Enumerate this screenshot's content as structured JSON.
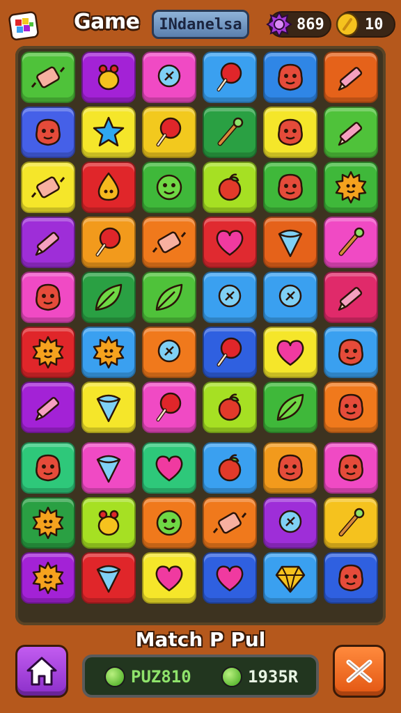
{
  "header": {
    "title": "Game",
    "level_label": "INdanelsa",
    "gems": "869",
    "coins": "10"
  },
  "colors": {
    "background": "#b5581c",
    "board": "#3d3320"
  },
  "board": {
    "rows": 10,
    "cols": 6,
    "tiles": [
      {
        "color": "#4fc23a",
        "icon": "candy-icon"
      },
      {
        "color": "#a322d6",
        "icon": "bug-icon"
      },
      {
        "color": "#f04ac4",
        "icon": "pin-icon"
      },
      {
        "color": "#3aa0f0",
        "icon": "lollipop-icon"
      },
      {
        "color": "#2f86e6",
        "icon": "monster-icon"
      },
      {
        "color": "#e5621a",
        "icon": "pencil-icon"
      },
      {
        "color": "#4560e8",
        "icon": "monster-icon"
      },
      {
        "color": "#f5e62a",
        "icon": "star-icon"
      },
      {
        "color": "#f2c91e",
        "icon": "lollipop-icon"
      },
      {
        "color": "#2aa043",
        "icon": "wand-icon"
      },
      {
        "color": "#f5e62a",
        "icon": "monster-icon"
      },
      {
        "color": "#4fc23a",
        "icon": "pencil-icon"
      },
      {
        "color": "#f5e62a",
        "icon": "candy-icon"
      },
      {
        "color": "#e0262a",
        "icon": "drop-icon"
      },
      {
        "color": "#3fb83a",
        "icon": "face-icon"
      },
      {
        "color": "#a6e023",
        "icon": "apple-icon"
      },
      {
        "color": "#3fb83a",
        "icon": "monster-icon"
      },
      {
        "color": "#3fb83a",
        "icon": "sun-icon"
      },
      {
        "color": "#9e2ed8",
        "icon": "pencil-icon"
      },
      {
        "color": "#f29a1c",
        "icon": "lollipop-icon"
      },
      {
        "color": "#f0791c",
        "icon": "candy-icon"
      },
      {
        "color": "#e02a30",
        "icon": "heart-icon"
      },
      {
        "color": "#e5621a",
        "icon": "cone-icon"
      },
      {
        "color": "#f04ac4",
        "icon": "wand-icon"
      },
      {
        "color": "#f04ac4",
        "icon": "monster-icon"
      },
      {
        "color": "#2aa043",
        "icon": "leaf-icon"
      },
      {
        "color": "#4fc23a",
        "icon": "leaf-icon"
      },
      {
        "color": "#3aa0f0",
        "icon": "pin-icon"
      },
      {
        "color": "#3aa0f0",
        "icon": "pin-icon"
      },
      {
        "color": "#e02a6a",
        "icon": "pencil-icon"
      },
      {
        "color": "#e0262a",
        "icon": "sun-icon"
      },
      {
        "color": "#3aa0f0",
        "icon": "sun-icon"
      },
      {
        "color": "#f0791c",
        "icon": "pin-icon"
      },
      {
        "color": "#2f60e0",
        "icon": "lollipop-icon"
      },
      {
        "color": "#f5e62a",
        "icon": "heart-icon"
      },
      {
        "color": "#3aa0f0",
        "icon": "monster-icon"
      },
      {
        "color": "#a322d6",
        "icon": "pencil-icon"
      },
      {
        "color": "#f5e62a",
        "icon": "cone-icon"
      },
      {
        "color": "#f04ac4",
        "icon": "lollipop-icon"
      },
      {
        "color": "#a6e023",
        "icon": "apple-icon"
      },
      {
        "color": "#3fb83a",
        "icon": "leaf-icon"
      },
      {
        "color": "#f0791c",
        "icon": "monster-icon"
      },
      {
        "color": "#2ec87a",
        "icon": "monster-icon"
      },
      {
        "color": "#f04ac4",
        "icon": "cone-icon"
      },
      {
        "color": "#2ec87a",
        "icon": "heart-icon"
      },
      {
        "color": "#3aa0f0",
        "icon": "apple-icon"
      },
      {
        "color": "#f29a1c",
        "icon": "monster-icon"
      },
      {
        "color": "#f04ac4",
        "icon": "monster-icon"
      },
      {
        "color": "#2aa043",
        "icon": "sun-icon"
      },
      {
        "color": "#a6e023",
        "icon": "bug-icon"
      },
      {
        "color": "#f0791c",
        "icon": "face-icon"
      },
      {
        "color": "#f0791c",
        "icon": "candy-icon"
      },
      {
        "color": "#9e2ed8",
        "icon": "pin-icon"
      },
      {
        "color": "#f5c21e",
        "icon": "wand-icon"
      },
      {
        "color": "#a322d6",
        "icon": "sun-icon"
      },
      {
        "color": "#e0262a",
        "icon": "cone-icon"
      },
      {
        "color": "#f5e62a",
        "icon": "heart-icon"
      },
      {
        "color": "#2f60e0",
        "icon": "heart-icon"
      },
      {
        "color": "#3aa0f0",
        "icon": "gem-icon"
      },
      {
        "color": "#2f60e0",
        "icon": "monster-icon"
      }
    ]
  },
  "footer": {
    "match_label": "Match P Pul",
    "score_left": "PUZ810",
    "score_right": "1935R"
  }
}
